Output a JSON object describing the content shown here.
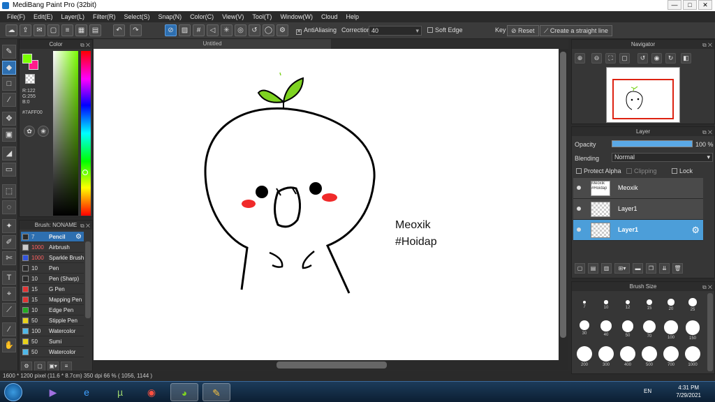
{
  "window": {
    "title": "MediBang Paint Pro (32bit)",
    "min": "—",
    "max": "□",
    "close": "✕"
  },
  "menu": [
    "File(F)",
    "Edit(E)",
    "Layer(L)",
    "Filter(R)",
    "Select(S)",
    "Snap(N)",
    "Color(C)",
    "View(V)",
    "Tool(T)",
    "Window(W)",
    "Cloud",
    "Help"
  ],
  "toolbar": {
    "antialiasing": "AntiAliasing",
    "correction_label": "Correction",
    "correction_value": "40",
    "soft_edge": "Soft Edge",
    "key": "Key",
    "reset": "Reset",
    "straight_line": "Create a straight line"
  },
  "color": {
    "title": "Color",
    "r": "R:122",
    "g": "G:255",
    "b": "B:0",
    "hex": "#7AFF00",
    "fg": "#7aff00",
    "bg": "#ff1a8c"
  },
  "brush": {
    "title": "Brush: NONAME",
    "items": [
      {
        "size": "7",
        "name": "Pencil",
        "color": "#2a2a2a"
      },
      {
        "size": "1000",
        "name": "Airbrush",
        "color": "#cccccc"
      },
      {
        "size": "1000",
        "name": "Sparkle Brush",
        "color": "#3355dd"
      },
      {
        "size": "10",
        "name": "Pen",
        "color": "#2a2a2a"
      },
      {
        "size": "10",
        "name": "Pen (Sharp)",
        "color": "#2a2a2a"
      },
      {
        "size": "15",
        "name": "G Pen",
        "color": "#e23333"
      },
      {
        "size": "15",
        "name": "Mapping Pen",
        "color": "#e23333"
      },
      {
        "size": "10",
        "name": "Edge Pen",
        "color": "#22aa22"
      },
      {
        "size": "50",
        "name": "Stipple Pen",
        "color": "#e8d21a"
      },
      {
        "size": "100",
        "name": "Watercolor",
        "color": "#4fb8e8"
      },
      {
        "size": "50",
        "name": "Sumi",
        "color": "#e8d21a"
      },
      {
        "size": "50",
        "name": "Watercolor",
        "color": "#4fb8e8"
      }
    ]
  },
  "canvas": {
    "tab": "Untitled",
    "text_line1": "Meoxik",
    "text_line2": "#Hoidap"
  },
  "status": {
    "text": "1600 * 1200 pixel  (11.6 * 8.7cm)  350 dpi  66 %  ( 1056, 1144 )"
  },
  "navigator": {
    "title": "Navigator"
  },
  "layer": {
    "title": "Layer",
    "opacity_label": "Opacity",
    "opacity_value": "100 %",
    "blending_label": "Blending",
    "blending_value": "Normal",
    "protect_alpha": "Protect Alpha",
    "clipping": "Clipping",
    "lock": "Lock",
    "items": [
      {
        "name": "Meoxik",
        "thumb": "Meoxik #Hoidap"
      },
      {
        "name": "Layer1"
      },
      {
        "name": "Layer1"
      }
    ]
  },
  "brush_size": {
    "title": "Brush Size",
    "sizes": [
      "7",
      "10",
      "12",
      "15",
      "20",
      "25",
      "30",
      "40",
      "50",
      "70",
      "100",
      "150",
      "200",
      "300",
      "400",
      "500",
      "700",
      "1000"
    ]
  },
  "taskbar": {
    "lang": "EN",
    "time": "4:31 PM",
    "date": "7/29/2021"
  }
}
